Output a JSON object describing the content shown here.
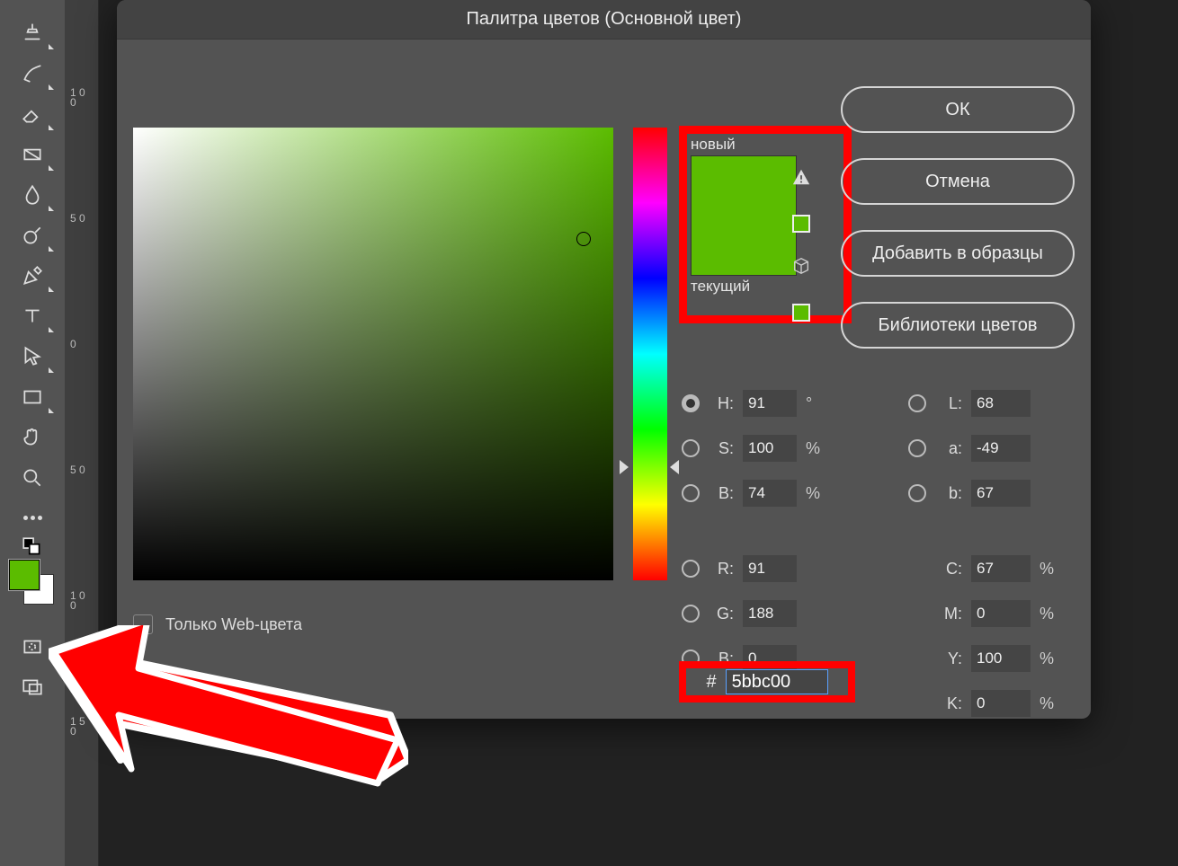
{
  "dialog": {
    "title": "Палитра цветов (Основной цвет)",
    "new_label": "новый",
    "current_label": "текущий",
    "web_only_label": "Только Web-цвета",
    "buttons": {
      "ok": "ОК",
      "cancel": "Отмена",
      "add_swatch": "Добавить в образцы",
      "libraries": "Библиотеки цветов"
    },
    "fields": {
      "H": {
        "label": "H:",
        "value": "91",
        "unit": "°"
      },
      "S": {
        "label": "S:",
        "value": "100",
        "unit": "%"
      },
      "Bv": {
        "label": "B:",
        "value": "74",
        "unit": "%"
      },
      "R": {
        "label": "R:",
        "value": "91"
      },
      "G": {
        "label": "G:",
        "value": "188"
      },
      "B": {
        "label": "B:",
        "value": "0"
      },
      "L": {
        "label": "L:",
        "value": "68"
      },
      "a": {
        "label": "a:",
        "value": "-49"
      },
      "b": {
        "label": "b:",
        "value": "67"
      },
      "C": {
        "label": "C:",
        "value": "67",
        "unit": "%"
      },
      "M": {
        "label": "M:",
        "value": "0",
        "unit": "%"
      },
      "Y": {
        "label": "Y:",
        "value": "100",
        "unit": "%"
      },
      "K": {
        "label": "K:",
        "value": "0",
        "unit": "%"
      }
    },
    "hex": {
      "hash": "#",
      "value": "5bbc00"
    }
  },
  "color": {
    "new_hex": "#5bbc00",
    "current_hex": "#5bbc00",
    "fg_hex": "#5bbc00",
    "bg_hex": "#ffffff"
  },
  "ruler": {
    "marks": [
      "1\n0\n0",
      "5\n0",
      "0",
      "5\n0",
      "1\n0\n0",
      "1\n5\n0"
    ]
  },
  "tools": [
    "stamp-tool",
    "history-brush-tool",
    "eraser-tool",
    "gradient-tool",
    "blur-tool",
    "dodge-tool",
    "pen-tool",
    "type-tool",
    "path-selection-tool",
    "rectangle-tool",
    "hand-tool",
    "zoom-tool",
    "edit-toolbar",
    "default-colors",
    "foreground-background",
    "quick-mask",
    "screen-mode"
  ]
}
